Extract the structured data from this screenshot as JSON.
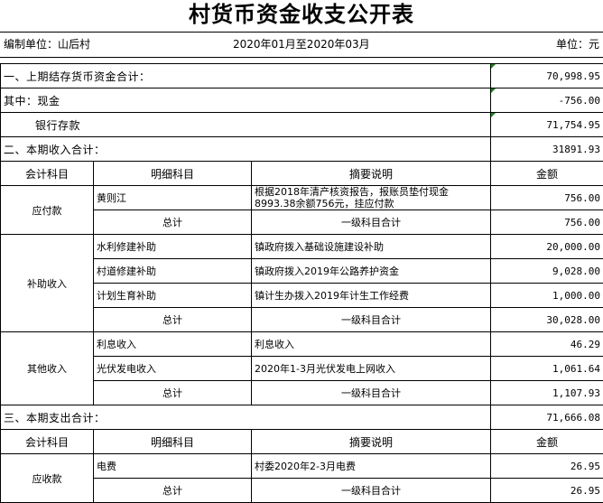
{
  "title": "村货币资金收支公开表",
  "meta": {
    "unit": "编制单位：山后村",
    "period": "2020年01月至2020年03月",
    "currency": "单位：元"
  },
  "summary": {
    "prev_balance_label": "一、上期结存货币资金合计：",
    "prev_balance_value": "70,998.95",
    "cash_label": "其中：现金",
    "cash_value": "-756.00",
    "bank_label": "银行存款",
    "bank_value": "71,754.95",
    "income_label": "二、本期收入合计：",
    "income_value": "31891.93",
    "expense_label": "三、本期支出合计：",
    "expense_value": "71,666.08"
  },
  "headers": {
    "account": "会计科目",
    "detail": "明细科目",
    "description": "摘要说明",
    "amount": "金额"
  },
  "income_groups": [
    {
      "account": "应付款",
      "rows": [
        {
          "detail": "黄则江",
          "description": "根据2018年清产核资报告，报账员垫付现金8993.38余额756元，挂应付款",
          "amount": "756.00"
        }
      ],
      "total_label": "总计",
      "total_desc": "一级科目合计",
      "total_amount": "756.00"
    },
    {
      "account": "补助收入",
      "rows": [
        {
          "detail": "水利修建补助",
          "description": "镇政府拨入基础设施建设补助",
          "amount": "20,000.00"
        },
        {
          "detail": "村道修建补助",
          "description": "镇政府拨入2019年公路养护资金",
          "amount": "9,028.00"
        },
        {
          "detail": "计划生育补助",
          "description": "镇计生办拨入2019年计生工作经费",
          "amount": "1,000.00"
        }
      ],
      "total_label": "总计",
      "total_desc": "一级科目合计",
      "total_amount": "30,028.00"
    },
    {
      "account": "其他收入",
      "rows": [
        {
          "detail": "利息收入",
          "description": "利息收入",
          "amount": "46.29"
        },
        {
          "detail": "光伏发电收入",
          "description": "2020年1-3月光伏发电上网收入",
          "amount": "1,061.64"
        }
      ],
      "total_label": "总计",
      "total_desc": "一级科目合计",
      "total_amount": "1,107.93"
    }
  ],
  "expense_groups": [
    {
      "account": "应收款",
      "rows": [
        {
          "detail": "电费",
          "description": "村委2020年2-3月电费",
          "amount": "26.95"
        }
      ],
      "total_label": "总计",
      "total_desc": "一级科目合计",
      "total_amount": "26.95"
    }
  ],
  "colors": {
    "flag": "#1a7f1a",
    "border": "#000000"
  }
}
